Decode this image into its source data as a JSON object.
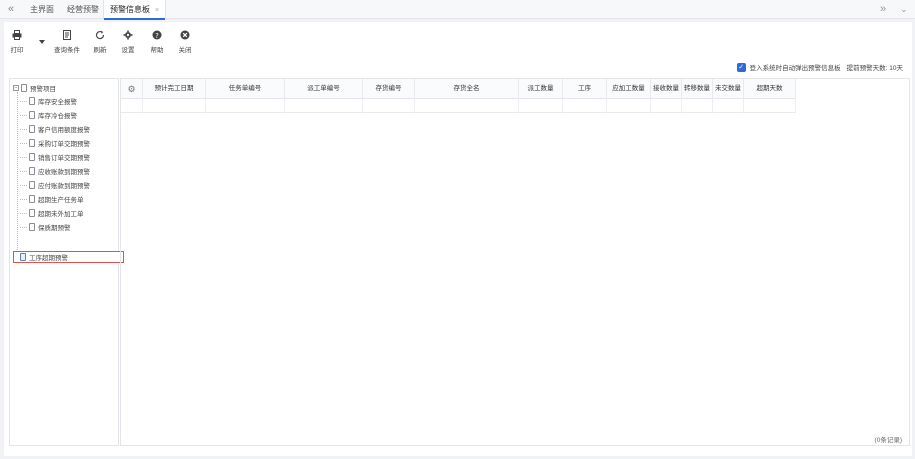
{
  "tabbar": {
    "tabs": [
      {
        "label": "主界面"
      },
      {
        "label": "经营预警"
      },
      {
        "label": "预警信息板",
        "active": true
      }
    ],
    "close_glyph": "×"
  },
  "toolbar": {
    "buttons": [
      {
        "label": "打印",
        "icon": "printer-icon"
      },
      {
        "label": "查询条件",
        "icon": "filter-icon"
      },
      {
        "label": "刷新",
        "icon": "refresh-icon"
      },
      {
        "label": "设置",
        "icon": "gear-icon"
      },
      {
        "label": "帮助",
        "icon": "help-icon"
      },
      {
        "label": "关闭",
        "icon": "close-circle-icon"
      }
    ]
  },
  "options": {
    "auto_popup_label": "登入系统时自动弹出预警信息板",
    "auto_popup_checked": true,
    "advance_days_label": "提前预警天数: 10天"
  },
  "tree": {
    "root_label": "预警项目",
    "items": [
      "库存安全报警",
      "库存冷仓报警",
      "客户信用额度报警",
      "采购订单交期预警",
      "销售订单交期预警",
      "应收账款到期预警",
      "应付账款到期预警",
      "超期生产任务单",
      "超期未外加工单",
      "保质期预警",
      "工序超期预警"
    ],
    "selected_index": 10
  },
  "grid": {
    "columns": [
      "预计完工日期",
      "任务单编号",
      "派工单编号",
      "存货编号",
      "存货全名",
      "派工数量",
      "工序",
      "应加工数量",
      "接收数量",
      "转移数量",
      "未交数量",
      "超期天数"
    ]
  },
  "footer": {
    "record_count": "(0条记录)"
  },
  "colors": {
    "accent": "#2d6bd4",
    "selected_border": "#d9534f"
  }
}
